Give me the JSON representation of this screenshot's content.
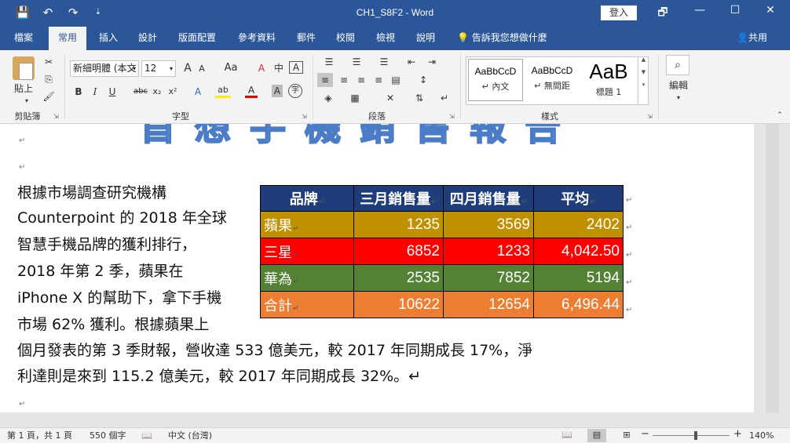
{
  "app": {
    "title": "CH1_S8F2 - Word",
    "login": "登入",
    "quick_access": [
      "💾",
      "↶",
      "↷",
      "⇣"
    ],
    "window_controls": [
      "🗗",
      "—",
      "☐",
      "✕"
    ]
  },
  "tabs": [
    "檔案",
    "常用",
    "插入",
    "設計",
    "版面配置",
    "參考資料",
    "郵件",
    "校閱",
    "檢視",
    "說明"
  ],
  "active_tab": "常用",
  "tell_me": "告訴我您想做什麼",
  "share": "共用",
  "ribbon": {
    "clipboard": {
      "paste": "貼上",
      "label": "剪貼簿"
    },
    "font": {
      "name": "新細明體 (本文",
      "size": "12",
      "grow": "A",
      "shrink": "A",
      "case": "Aa",
      "clear": "A",
      "phonetic": "中",
      "border_char": "A",
      "bold": "B",
      "italic": "I",
      "underline": "U",
      "strike": "abc",
      "subscript": "x₂",
      "superscript": "x²",
      "effects": "A",
      "highlight": "ab",
      "font_color": "A",
      "shade": "A",
      "enclose": "字",
      "label": "字型"
    },
    "paragraph": {
      "label": "段落"
    },
    "styles": {
      "items": [
        {
          "sample": "AaBbCcD",
          "name": "↵ 內文"
        },
        {
          "sample": "AaBbCcD",
          "name": "↵ 無間距"
        },
        {
          "sample": "AaB",
          "name": "標題 1"
        }
      ],
      "label": "樣式"
    },
    "editing": {
      "label": "編輯"
    }
  },
  "document": {
    "title_art": "首 想 手 機 銷 售 報 告",
    "para_left": [
      "根據市場調查研究機構",
      "Counterpoint  的  2018  年全球",
      "智慧手機品牌的獲利排行，",
      "2018  年第  2  季，蘋果在",
      "iPhone X  的幫助下，拿下手機",
      "市場  62%  獲利。根據蘋果上"
    ],
    "para_full": [
      "個月發表的第  3  季財報，營收達  533  億美元，較  2017  年同期成長  17%，淨",
      "利達則是來到  115.2  億美元，較  2017  年同期成長  32%。↵"
    ],
    "para_mark": "↵",
    "table": {
      "headers": [
        "品牌",
        "三月銷售量",
        "四月銷售量",
        "平均"
      ],
      "rows": [
        {
          "brand": "蘋果",
          "march": "1235",
          "april": "3569",
          "avg": "2402",
          "color": "#bf9000"
        },
        {
          "brand": "三星",
          "march": "6852",
          "april": "1233",
          "avg": "4,042.50",
          "color": "#ff0000"
        },
        {
          "brand": "華為",
          "march": "2535",
          "april": "7852",
          "avg": "5194",
          "color": "#548235"
        },
        {
          "brand": "合計",
          "march": "10622",
          "april": "12654",
          "avg": "6,496.44",
          "color": "#ed7d31"
        }
      ],
      "header_color": "#1f3d7a"
    }
  },
  "status": {
    "page": "第 1 頁，共 1 頁",
    "words": "550 個字",
    "language": "中文 (台灣)",
    "zoom": "140%",
    "zoom_level_fraction": 0.56
  },
  "colors": {
    "accent": "#2b579a"
  }
}
